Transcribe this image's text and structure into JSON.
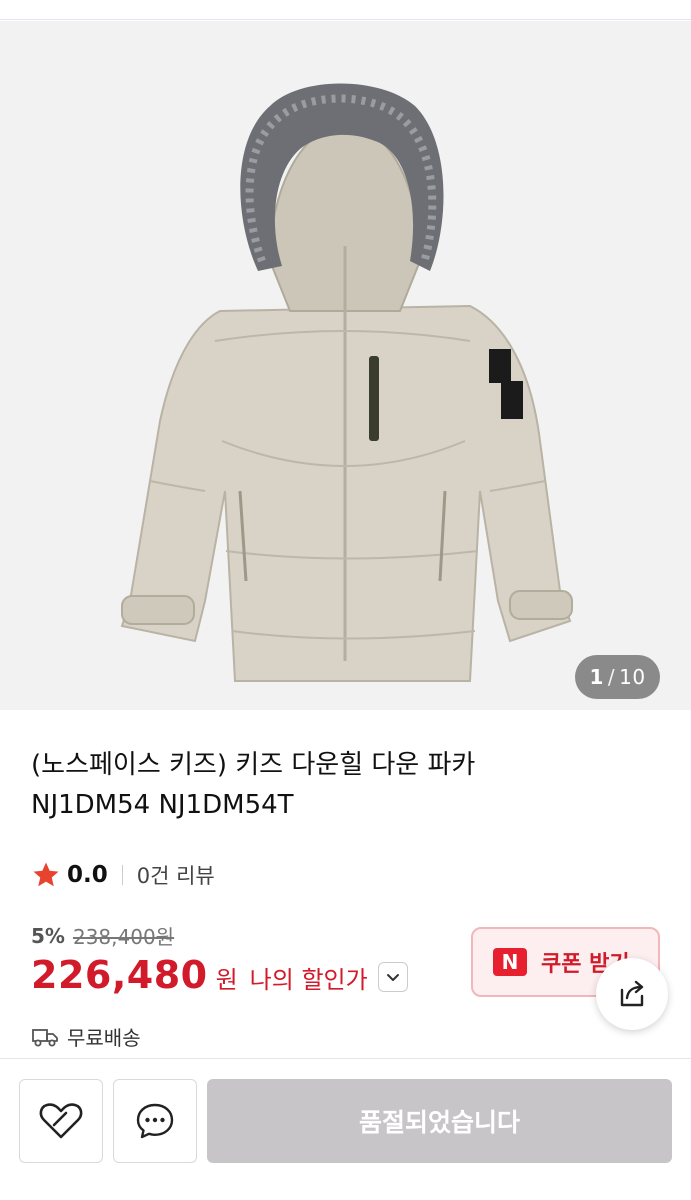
{
  "gallery": {
    "current": "1",
    "separator": "/",
    "total": "10"
  },
  "product": {
    "title_line1": "(노스페이스 키즈) 키즈 다운힐 다운 파카",
    "title_line2": "NJ1DM54 NJ1DM54T"
  },
  "rating": {
    "score": "0.0",
    "review_text": "0건 리뷰",
    "star_color": "#e8432e"
  },
  "price": {
    "discount_rate": "5%",
    "original_price": "238,400원",
    "sale_price": "226,480",
    "currency": "원",
    "my_discount_label": "나의 할인가",
    "price_color": "#d11a2a"
  },
  "coupon": {
    "logo_letter": "N",
    "label": "쿠폰 받기"
  },
  "shipping": {
    "label": "무료배송"
  },
  "bottom_bar": {
    "soldout_label": "품절되었습니다"
  },
  "icons": {
    "like": "heart-outline-icon",
    "chat": "chat-bubble-icon",
    "share": "share-icon",
    "truck": "truck-icon",
    "star": "star-icon",
    "chevron": "chevron-down-icon"
  }
}
